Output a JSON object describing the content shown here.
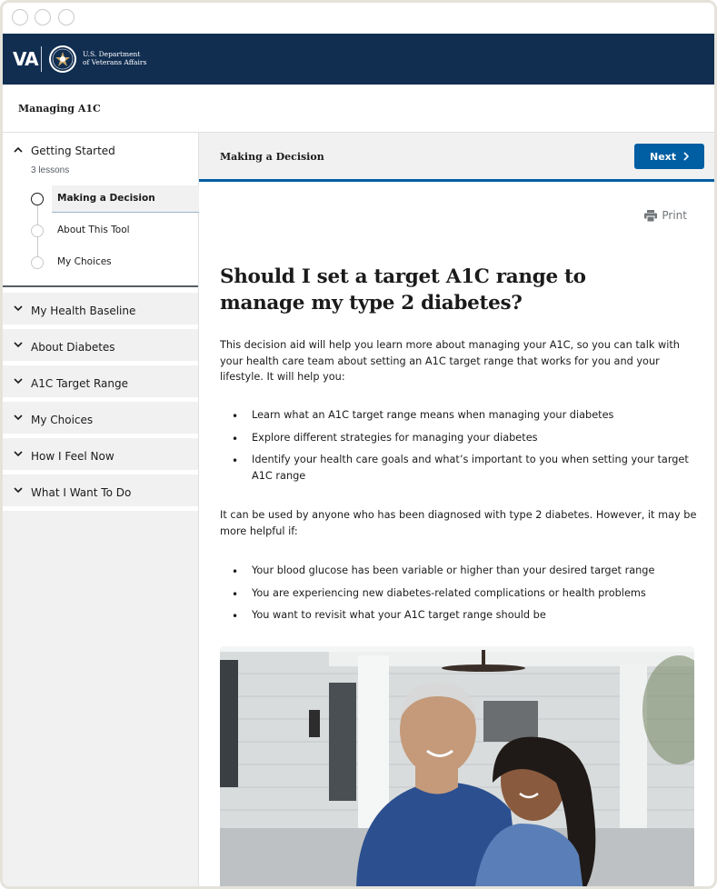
{
  "header": {
    "logo_text": "VA",
    "dept_line1": "U.S. Department",
    "dept_line2": "of Veterans Affairs"
  },
  "course": {
    "title": "Managing A1C"
  },
  "sidebar": {
    "open_section": {
      "title": "Getting Started",
      "subtitle": "3 lessons",
      "lessons": [
        {
          "label": "Making a Decision",
          "active": true
        },
        {
          "label": "About This Tool",
          "active": false
        },
        {
          "label": "My Choices",
          "active": false
        }
      ]
    },
    "sections": [
      {
        "label": "My Health Baseline"
      },
      {
        "label": "About Diabetes"
      },
      {
        "label": "A1C Target Range"
      },
      {
        "label": "My Choices"
      },
      {
        "label": "How I Feel Now"
      },
      {
        "label": "What I Want To Do"
      }
    ]
  },
  "main": {
    "lesson_title": "Making a Decision",
    "next_label": "Next",
    "print_label": "Print",
    "heading": "Should I set a target A1C range to manage my type 2 diabetes?",
    "intro": "This decision aid will help you learn more about managing your A1C, so you can talk with your health care team about setting an A1C target range that works for you and your lifestyle. It will help you:",
    "bullets1": [
      "Learn what an A1C target range means when managing your diabetes",
      "Explore different strategies for managing your diabetes",
      "Identify your health care goals and what’s important to you when setting your target A1C range"
    ],
    "para2": "It can be used by anyone who has been diagnosed with type 2 diabetes. However, it may be more helpful if:",
    "bullets2": [
      "Your blood glucose has been variable or higher than your desired target range",
      "You are experiencing new diabetes-related complications or health problems",
      "You want to revisit what your A1C target range should be"
    ]
  },
  "colors": {
    "header_bg": "#112e51",
    "primary": "#005ea2"
  },
  "icons": [
    "chevron-up-icon",
    "chevron-down-icon",
    "chevron-right-icon",
    "printer-icon",
    "va-seal-icon"
  ]
}
